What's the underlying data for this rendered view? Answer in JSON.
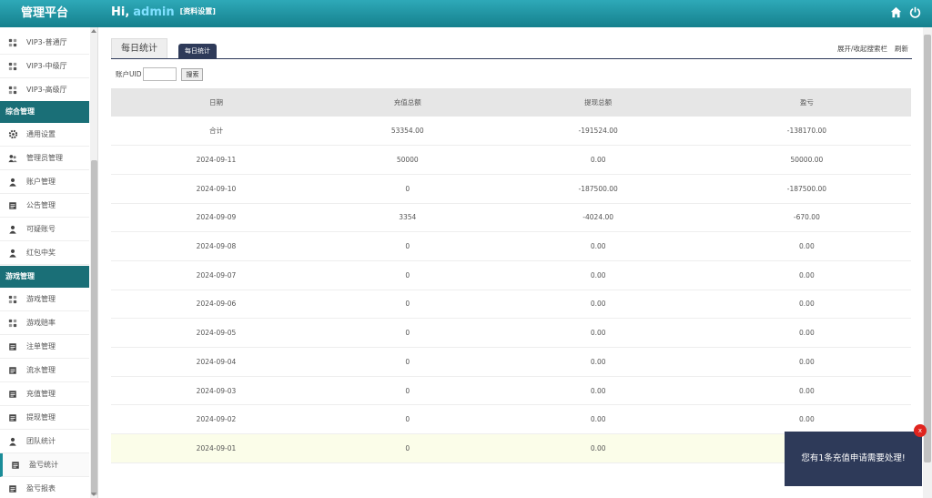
{
  "header": {
    "brand": "管理平台",
    "greeting": "Hi,",
    "username": "admin",
    "profile_link": "[资料设置]"
  },
  "sidebar": {
    "items": [
      {
        "label": "VIP3-普通厅",
        "icon": "grid-icon"
      },
      {
        "label": "VIP3-中级厅",
        "icon": "grid-icon"
      },
      {
        "label": "VIP3-高级厅",
        "icon": "grid-icon"
      },
      {
        "section": "综合管理"
      },
      {
        "label": "通用设置",
        "icon": "gear-icon"
      },
      {
        "label": "管理员管理",
        "icon": "users-icon"
      },
      {
        "label": "账户管理",
        "icon": "user-icon"
      },
      {
        "label": "公告管理",
        "icon": "doc-icon"
      },
      {
        "label": "可疑账号",
        "icon": "user-icon"
      },
      {
        "label": "红包中奖",
        "icon": "user-icon"
      },
      {
        "section": "游戏管理"
      },
      {
        "label": "游戏管理",
        "icon": "grid-icon"
      },
      {
        "label": "游戏赔率",
        "icon": "grid-icon"
      },
      {
        "label": "注单管理",
        "icon": "doc-icon"
      },
      {
        "label": "流水管理",
        "icon": "doc-icon"
      },
      {
        "label": "充值管理",
        "icon": "doc-icon"
      },
      {
        "label": "提现管理",
        "icon": "doc-icon"
      },
      {
        "label": "团队统计",
        "icon": "user-icon"
      },
      {
        "label": "盈亏统计",
        "icon": "doc-icon",
        "active": true
      },
      {
        "label": "盈亏报表",
        "icon": "doc-icon"
      }
    ]
  },
  "tabs": {
    "main": "每日统计",
    "sub": "每日统计"
  },
  "top_links": {
    "toggle": "展开/收起搜索栏",
    "refresh": "刷新"
  },
  "search": {
    "label": "账户UID",
    "value": "",
    "button": "搜索"
  },
  "table": {
    "headers": [
      "日期",
      "充值总额",
      "提现总额",
      "盈亏"
    ],
    "rows": [
      [
        "合计",
        "53354.00",
        "-191524.00",
        "-138170.00"
      ],
      [
        "2024-09-11",
        "50000",
        "0.00",
        "50000.00"
      ],
      [
        "2024-09-10",
        "0",
        "-187500.00",
        "-187500.00"
      ],
      [
        "2024-09-09",
        "3354",
        "-4024.00",
        "-670.00"
      ],
      [
        "2024-09-08",
        "0",
        "0.00",
        "0.00"
      ],
      [
        "2024-09-07",
        "0",
        "0.00",
        "0.00"
      ],
      [
        "2024-09-06",
        "0",
        "0.00",
        "0.00"
      ],
      [
        "2024-09-05",
        "0",
        "0.00",
        "0.00"
      ],
      [
        "2024-09-04",
        "0",
        "0.00",
        "0.00"
      ],
      [
        "2024-09-03",
        "0",
        "0.00",
        "0.00"
      ],
      [
        "2024-09-02",
        "0",
        "0.00",
        "0.00"
      ],
      [
        "2024-09-01",
        "0",
        "0.00",
        ""
      ]
    ]
  },
  "toast": {
    "message": "您有1条充值申请需要处理!",
    "close": "x"
  },
  "colors": {
    "header": "#1a8c98",
    "section": "#1a6f77",
    "navy": "#2e3a59",
    "alert": "#e0241e"
  }
}
